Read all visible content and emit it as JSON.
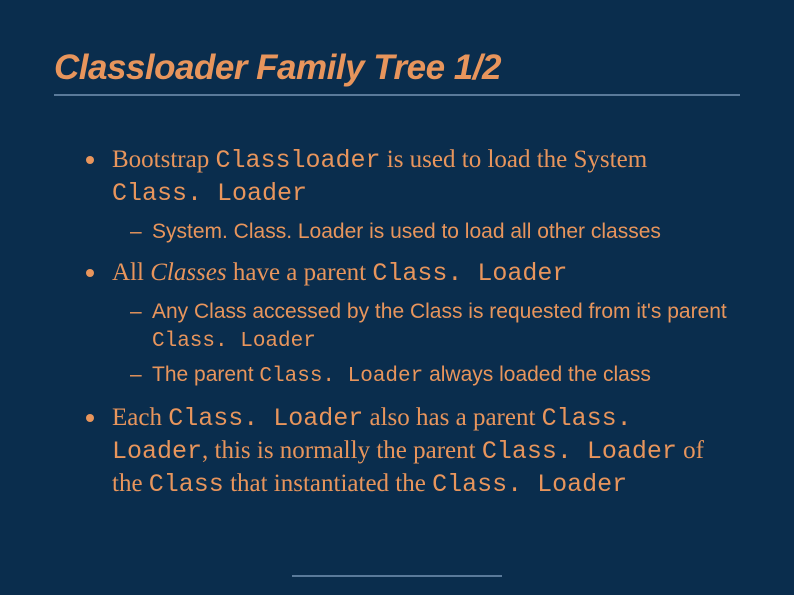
{
  "title": "Classloader Family Tree 1/2",
  "bullets": {
    "b1": {
      "pre": "Bootstrap ",
      "code1": "Classloader",
      "mid": " is used to load the System ",
      "code2": "Class. Loader"
    },
    "b1s1": "System. Class. Loader is used to load all other classes",
    "b2": {
      "pre": "All ",
      "ital": "Classes",
      "mid": " have a parent ",
      "code": "Class. Loader"
    },
    "b2s1": {
      "pre": "Any Class accessed by the Class is requested from it's parent ",
      "code": "Class. Loader"
    },
    "b2s2": {
      "pre": "The parent ",
      "code": "Class. Loader",
      "post": " always loaded the class"
    },
    "b3": {
      "p1": "Each ",
      "c1": "Class. Loader",
      "p2": " also has a parent ",
      "c2": "Class. Loader",
      "p3": ", this is normally the parent ",
      "c3": "Class. Loader",
      "p4": " of the ",
      "c4": "Class",
      "p5": " that instantiated the ",
      "c5": "Class. Loader"
    }
  }
}
